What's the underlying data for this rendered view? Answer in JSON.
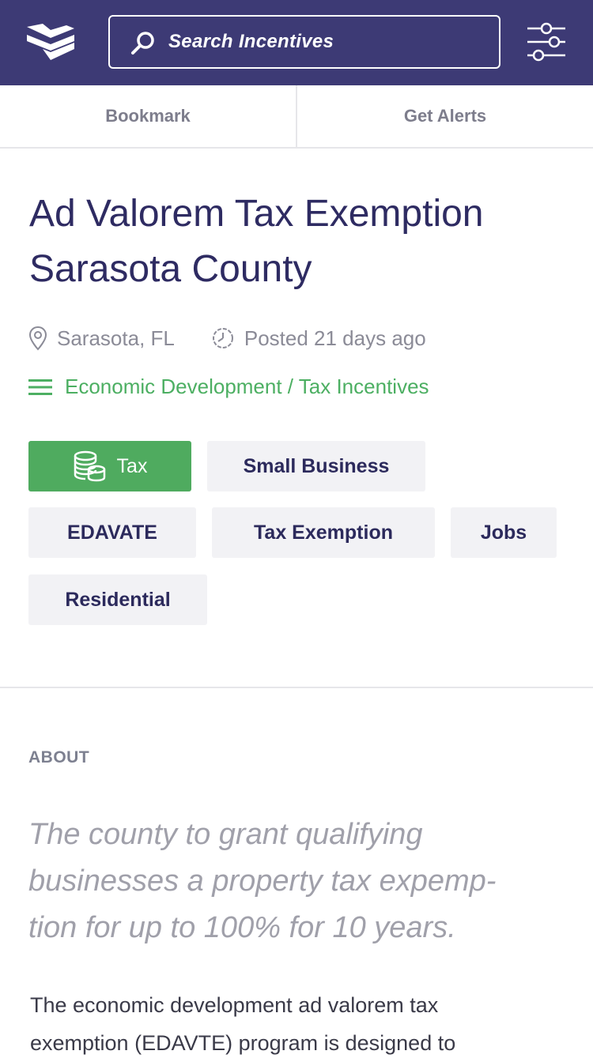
{
  "header": {
    "search_placeholder": "Search Incentives",
    "logo_icon": "brand-logo",
    "filter_icon": "sliders-icon",
    "background_color": "#3d3a75"
  },
  "actions": {
    "bookmark_label": "Bookmark",
    "alerts_label": "Get Alerts"
  },
  "listing": {
    "title_line1": "Ad Valorem Tax Exemption",
    "title_line2": "Sarasota County",
    "location": "Sarasota, FL",
    "posted": "Posted 21 days ago",
    "category": "Economic Development / Tax Incentives",
    "tags": [
      "Tax",
      "Small Business",
      "EDAVATE",
      "Tax Exemption",
      "Jobs",
      "Residential"
    ],
    "accent_color": "#4fab5f"
  },
  "about": {
    "label": "ABOUT",
    "lead_line1": "The county to grant qualifying",
    "lead_line2": "businesses a property tax expemp-",
    "lead_line3": "tion for up to 100% for 10 years.",
    "body_line1": "The economic development ad valorem tax",
    "body_line2": "exemption (EDAVTE) program is designed to"
  }
}
